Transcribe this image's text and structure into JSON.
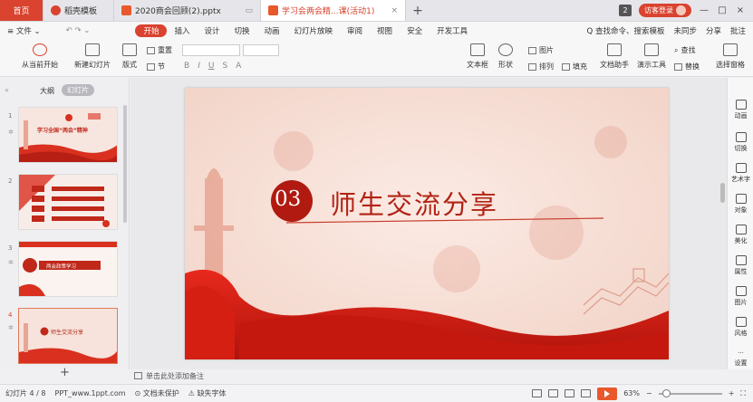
{
  "tabs": {
    "home": "首页",
    "docer": "稻壳模板",
    "file1": "2020商会回顾(2).pptx",
    "file2": "学习会两会精...课(活动1)",
    "add": "+",
    "badge": "2",
    "login": "访客登录",
    "win_min": "—",
    "win_max": "□",
    "win_close": "×"
  },
  "menu": {
    "file": "≡ 文件 ⌄",
    "items": [
      "开始",
      "插入",
      "设计",
      "切换",
      "动画",
      "幻灯片放映",
      "审阅",
      "视图",
      "安全",
      "开发工具"
    ],
    "search": "Q 查找命令、搜索模板",
    "unsync": "未同步",
    "share": "分享",
    "comment": "批注"
  },
  "ribbon": {
    "from_current": "从当前开始",
    "new_slide": "新建幻灯片",
    "layout": "版式",
    "reset": "重置",
    "section": "节",
    "textbox": "文本框",
    "shape": "形状",
    "arrange": "排列",
    "picture": "图片",
    "fill": "填充",
    "doc_assist": "文档助手",
    "play": "演示工具",
    "replace": "替换",
    "find": "查找",
    "select_pane": "选择窗格"
  },
  "left_panel": {
    "collapse": "«",
    "tab_outline": "大纲",
    "tab_slides": "幻灯片",
    "add": "+",
    "thumbs": [
      {
        "num": "1",
        "title": "学习全国“两会”精神"
      },
      {
        "num": "2",
        "title": ""
      },
      {
        "num": "3",
        "title": "两会政策学习"
      },
      {
        "num": "4",
        "title": "师生交流分享"
      }
    ]
  },
  "slide": {
    "number": "03",
    "title": "师生交流分享"
  },
  "side_panel": [
    "动画",
    "切换",
    "艺术字",
    "对象",
    "美化",
    "属性",
    "图片",
    "风格",
    "设置"
  ],
  "notes": "单击此处添加备注",
  "status": {
    "slide_counter": "幻灯片 4 / 8",
    "template": "PPT_www.1ppt.com",
    "protect": "文档未保护",
    "font_missing": "缺失字体",
    "zoom": "63%",
    "zoom_fraction": 0.06,
    "accent": "#d9432f"
  }
}
